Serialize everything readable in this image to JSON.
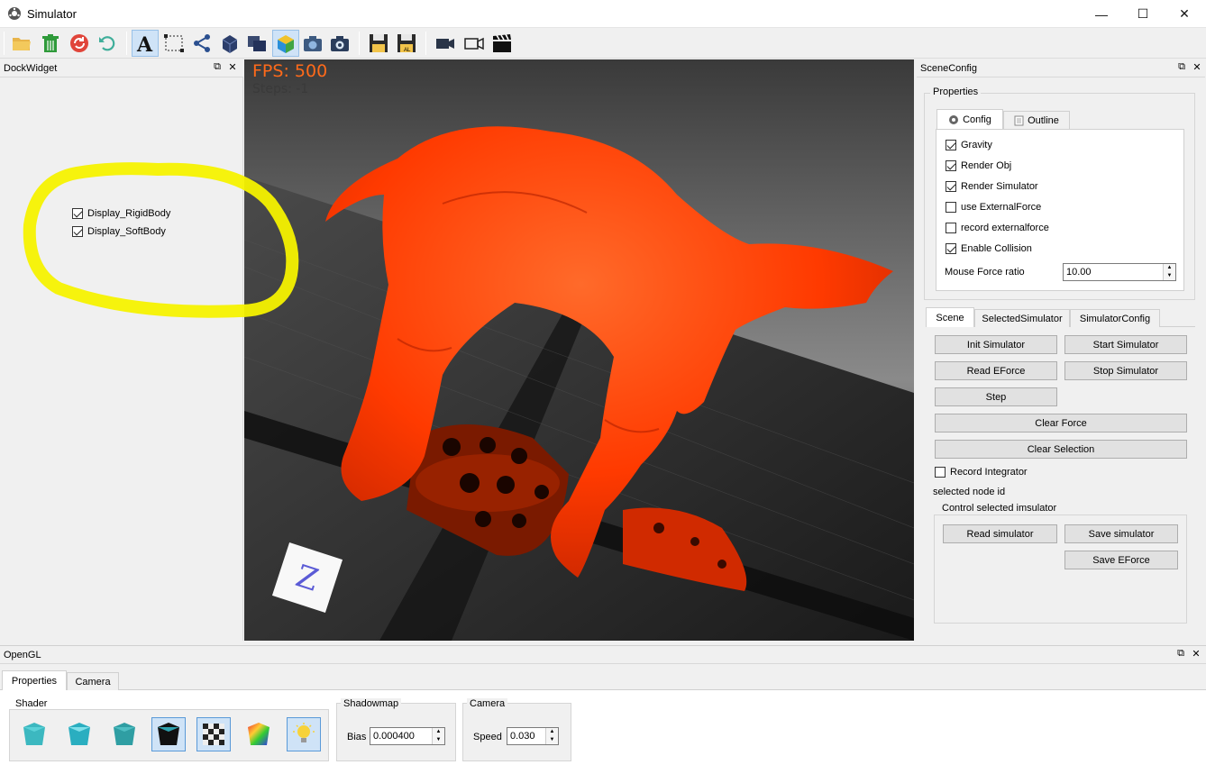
{
  "window": {
    "title": "Simulator",
    "minimize": "—",
    "maximize": "☐",
    "close": "✕"
  },
  "toolbar": {
    "icons": [
      "open-folder-icon",
      "trash-icon",
      "reload-icon",
      "undo-icon",
      "text-icon",
      "select-rect-icon",
      "share-graph-icon",
      "cube-icon",
      "stacked-cubes-icon",
      "color-cube-icon",
      "camera-icon",
      "snapshot-camera-icon",
      "save-icon",
      "save-all-icon",
      "video-camera-icon",
      "record-camera-icon",
      "clapperboard-icon"
    ]
  },
  "left_dock": {
    "title": "DockWidget",
    "checkboxes": [
      {
        "label": "Display_RigidBody",
        "checked": true
      },
      {
        "label": "Display_SoftBody",
        "checked": true
      }
    ]
  },
  "viewport": {
    "fps": "FPS: 500",
    "steps": "Steps: -1",
    "axis_label": "Z",
    "fps_color": "#ff6a1a",
    "model_color": "#ff3300"
  },
  "scene_config": {
    "title": "SceneConfig",
    "properties_label": "Properties",
    "tabs": [
      {
        "label": "Config",
        "selected": true
      },
      {
        "label": "Outline",
        "selected": false
      }
    ],
    "options": [
      {
        "label": "Gravity",
        "checked": true
      },
      {
        "label": "Render Obj",
        "checked": true
      },
      {
        "label": "Render Simulator",
        "checked": true
      },
      {
        "label": "use ExternalForce",
        "checked": false
      },
      {
        "label": "record externalforce",
        "checked": false
      },
      {
        "label": "Enable Collision",
        "checked": true
      }
    ],
    "mouse_force_label": "Mouse Force ratio",
    "mouse_force_value": "10.00",
    "lower_tabs": [
      {
        "label": "Scene",
        "selected": true
      },
      {
        "label": "SelectedSimulator",
        "selected": false
      },
      {
        "label": "SimulatorConfig",
        "selected": false
      }
    ],
    "buttons": {
      "init": "Init Simulator",
      "start": "Start Simulator",
      "read_eforce": "Read EForce",
      "stop": "Stop Simulator",
      "step": "Step",
      "clear_force": "Clear Force",
      "clear_selection": "Clear Selection"
    },
    "record_integrator": {
      "label": "Record Integrator",
      "checked": false
    },
    "selected_node_label": "selected node id",
    "control_group_label": "Control selected imsulator",
    "control_buttons": {
      "read_sim": "Read simulator",
      "save_sim": "Save simulator",
      "save_eforce": "Save EForce"
    }
  },
  "opengl_dock": {
    "title": "OpenGL",
    "tabs": [
      {
        "label": "Properties",
        "selected": true
      },
      {
        "label": "Camera",
        "selected": false
      }
    ],
    "shader_label": "Shader",
    "shadowmap_label": "Shadowmap",
    "bias_label": "Bias",
    "bias_value": "0.000400",
    "camera_label": "Camera",
    "speed_label": "Speed",
    "speed_value": "0.030"
  }
}
